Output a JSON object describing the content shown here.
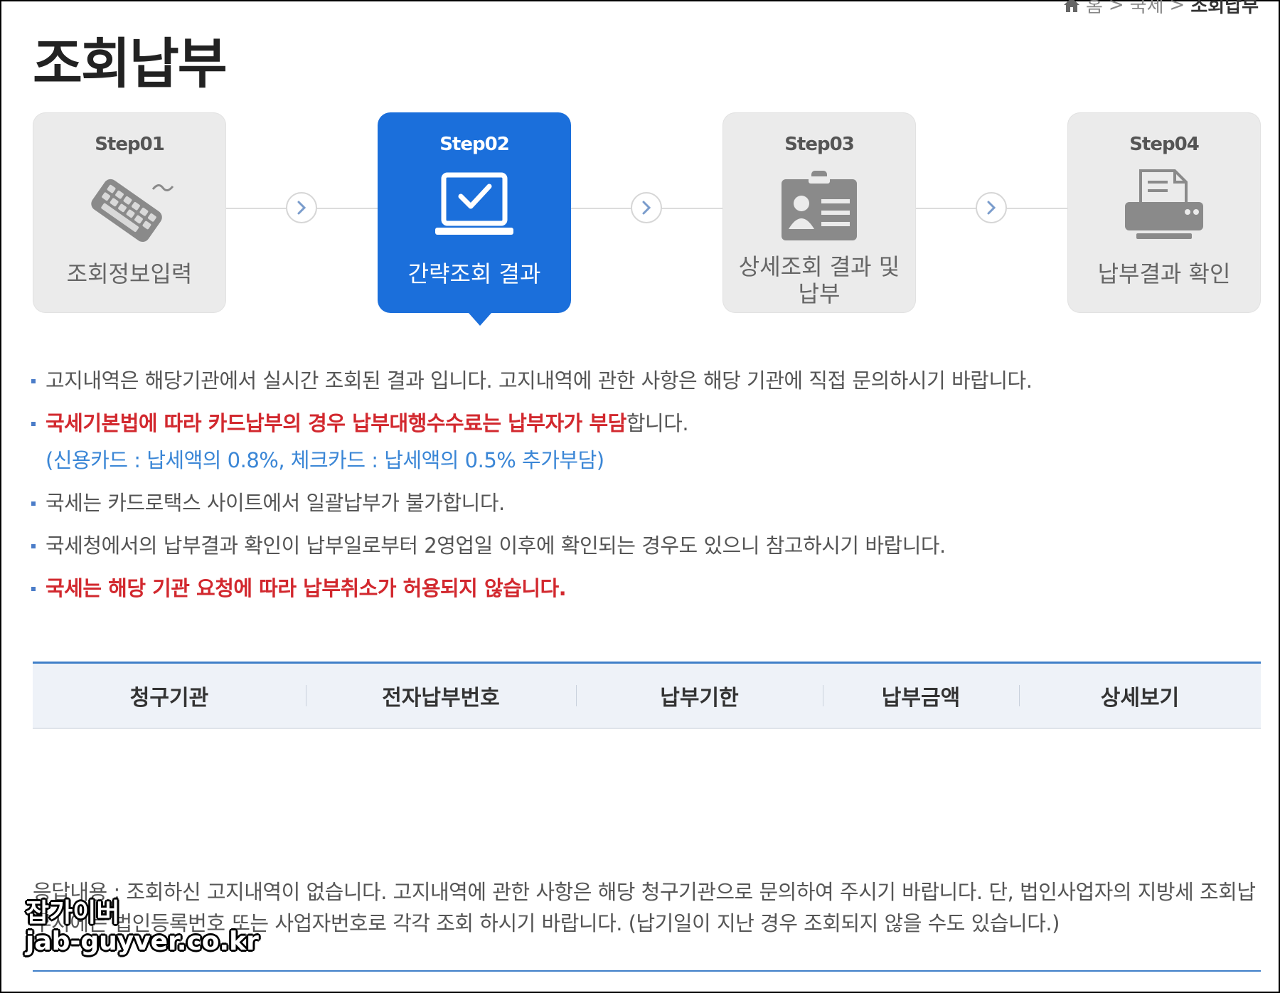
{
  "breadcrumb": {
    "items": [
      "홈",
      "국세",
      "조회납부"
    ],
    "separator": ">"
  },
  "page": {
    "title": "조회납부"
  },
  "steps": [
    {
      "number": "Step01",
      "label": "조회정보입력",
      "icon": "keyboard-icon",
      "active": false
    },
    {
      "number": "Step02",
      "label": "간략조회 결과",
      "icon": "laptop-check-icon",
      "active": true
    },
    {
      "number": "Step03",
      "label": "상세조회 결과 및 납부",
      "icon": "id-card-icon",
      "active": false
    },
    {
      "number": "Step04",
      "label": "납부결과 확인",
      "icon": "printer-icon",
      "active": false
    }
  ],
  "notices": {
    "n1": "고지내역은 해당기관에서 실시간 조회된 결과 입니다. 고지내역에 관한 사항은 해당 기관에 직접 문의하시기 바랍니다.",
    "n2_red": "국세기본법에 따라 카드납부의 경우 납부대행수수료는 납부자가 부담",
    "n2_rest": "합니다.",
    "n2_sub": "(신용카드 : 납세액의 0.8%, 체크카드 : 납세액의 0.5% 추가부담)",
    "n3": "국세는 카드로택스 사이트에서 일괄납부가 불가합니다.",
    "n4": "국세청에서의 납부결과 확인이 납부일로부터 2영업일 이후에 확인되는 경우도 있으니 참고하시기 바랍니다.",
    "n5": "국세는 해당 기관 요청에 따라 납부취소가 허용되지 않습니다."
  },
  "table": {
    "columns": [
      "청구기관",
      "전자납부번호",
      "납부기한",
      "납부금액",
      "상세보기"
    ]
  },
  "response": {
    "text": "응답내용 : 조회하신 고지내역이 없습니다. 고지내역에 관한 사항은 해당 청구기관으로 문의하여 주시기 바랍니다. 단, 법인사업자의 지방세 조회납부시에는 법인등록번호 또는 사업자번호로 각각 조회 하시기 바랍니다. (납기일이 지난 경우 조회되지 않을 수도 있습니다.)"
  },
  "watermark": {
    "line1": "잡가이버",
    "line2": "jab-guyver.co.kr"
  },
  "colors": {
    "accent": "#1b6fdb",
    "red": "#d2282e",
    "info_blue": "#3a86d6",
    "table_border": "#3f7fc8"
  }
}
